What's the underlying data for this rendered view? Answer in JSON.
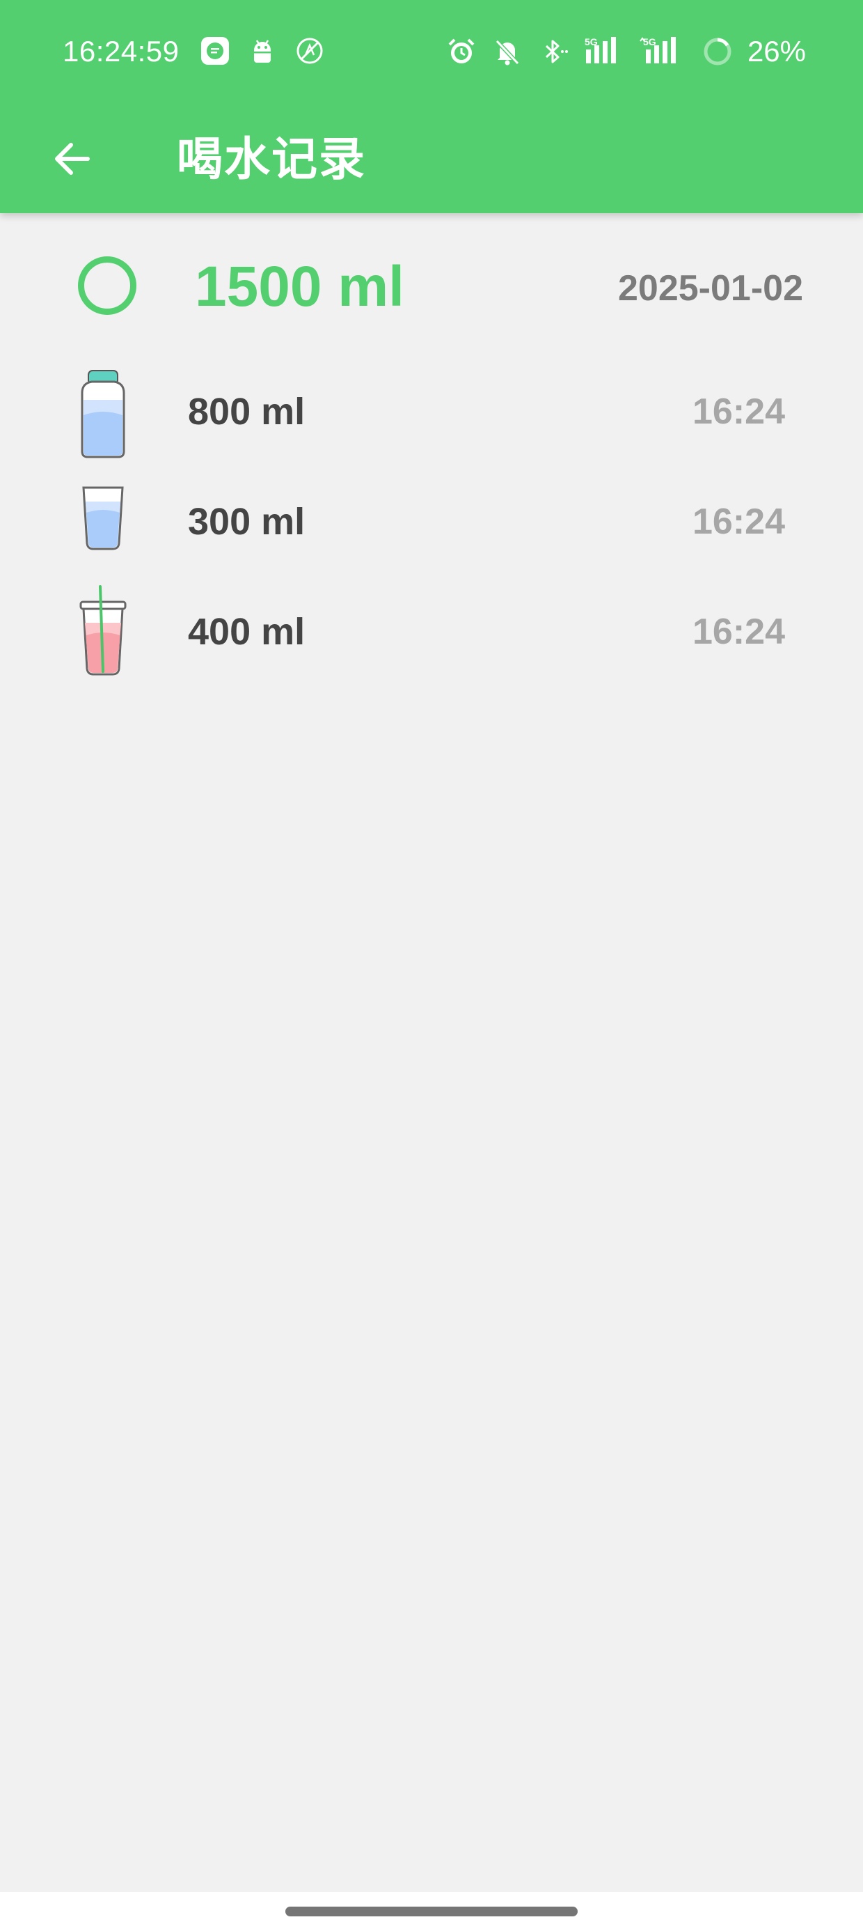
{
  "status_bar": {
    "time": "16:24:59",
    "battery": "26%",
    "left_icons": [
      "message-icon",
      "android-icon",
      "no-disturb-icon"
    ],
    "right_icons": [
      "alarm-icon",
      "muted-bell-icon",
      "bluetooth-icon",
      "signal-5g-icon",
      "signal-5g-2-icon",
      "battery-ring-icon"
    ]
  },
  "app_bar": {
    "title": "喝水记录",
    "back_icon": "arrow-left-icon"
  },
  "summary": {
    "total": "1500 ml",
    "date": "2025-01-02",
    "progress": 0
  },
  "records": [
    {
      "icon": "bottle-icon",
      "amount": "800 ml",
      "time": "16:24"
    },
    {
      "icon": "glass-icon",
      "amount": "300 ml",
      "time": "16:24"
    },
    {
      "icon": "cup-with-straw-icon",
      "amount": "400 ml",
      "time": "16:24"
    }
  ],
  "colors": {
    "primary": "#53cf6f",
    "background": "#f1f1f1",
    "amount_text": "#444444",
    "time_text": "#a6a6a6",
    "date_text": "#7b7b7b"
  }
}
